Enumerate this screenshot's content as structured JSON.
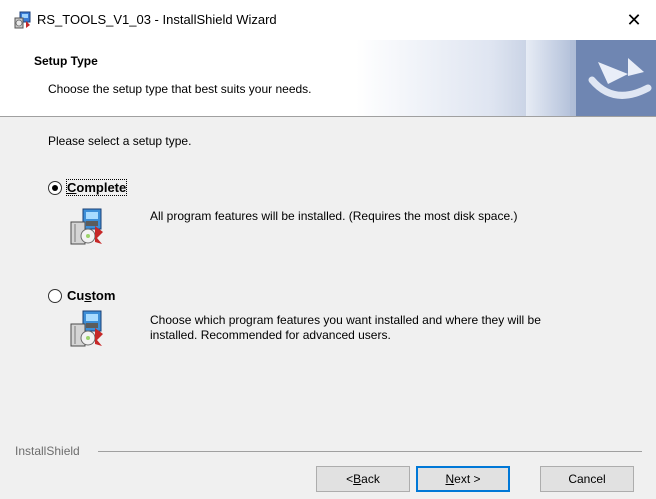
{
  "window": {
    "title": "RS_TOOLS_V1_03 - InstallShield Wizard",
    "close_glyph": "✕"
  },
  "banner": {
    "title": "Setup Type",
    "subtitle": "Choose the setup type that best suits your needs."
  },
  "body": {
    "prompt": "Please select a setup type."
  },
  "options": [
    {
      "label_before": "",
      "label_accel": "C",
      "label_after": "omplete",
      "selected": true,
      "description": "All program features will be installed. (Requires the most disk space.)"
    },
    {
      "label_before": "Cu",
      "label_accel": "s",
      "label_after": "tom",
      "selected": false,
      "description": "Choose which program features you want installed and where they will be installed. Recommended for advanced users."
    }
  ],
  "footer": {
    "brand": "InstallShield",
    "back_before": "< ",
    "back_accel": "B",
    "back_after": "ack",
    "next_accel": "N",
    "next_after": "ext >",
    "cancel_label": "Cancel"
  },
  "colors": {
    "accent": "#0078d7",
    "dialog_bg": "#f0f0f0"
  },
  "icons": {
    "title": "installshield-package-icon",
    "option": "setup-package-icon",
    "banner": "installshield-logo-icon"
  }
}
